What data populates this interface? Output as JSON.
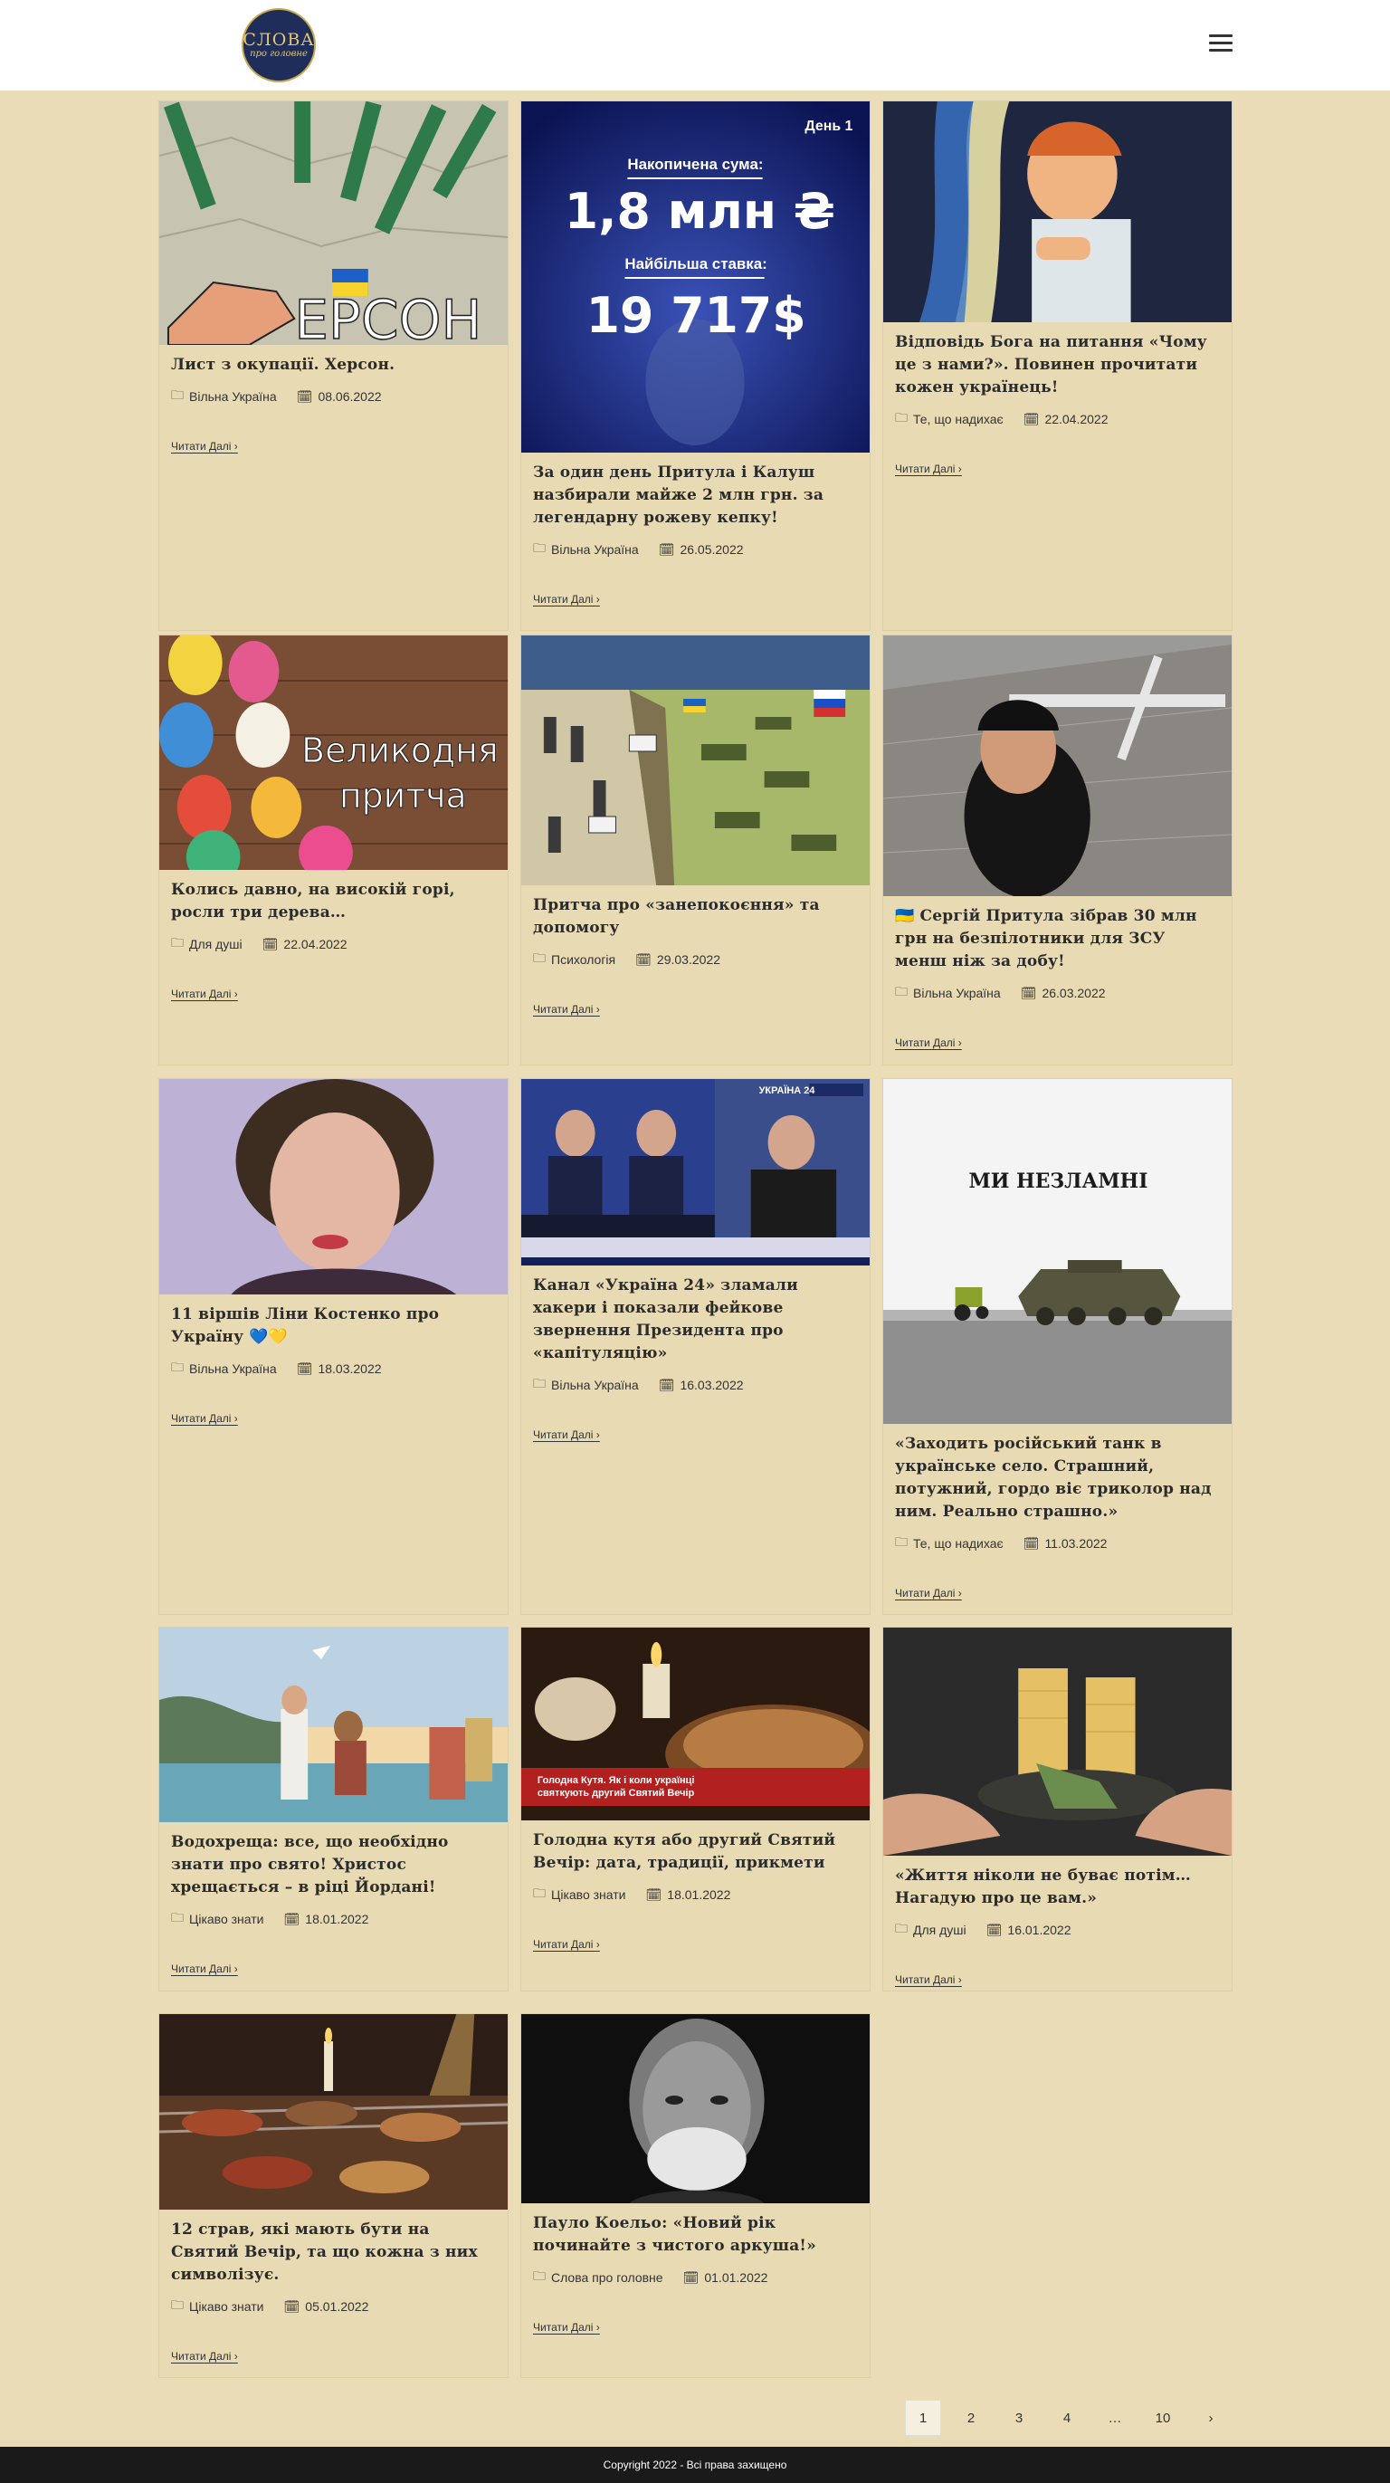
{
  "logo": {
    "line1": "СЛОВА",
    "line2": "про головне"
  },
  "read_more": "Читати Далі ›",
  "posts": [
    {
      "title": "Лист з окупації. Херсон.",
      "category": "Вільна Україна",
      "date": "08.06.2022"
    },
    {
      "title": "За один день Притула і Калуш назбирали майже 2 млн грн. за легендарну рожеву кепку!",
      "category": "Вільна Україна",
      "date": "26.05.2022"
    },
    {
      "title": "Відповідь Бога на питання «Чому це з нами?». Повинен прочитати кожен українець!",
      "category": "Те, що надихає",
      "date": "22.04.2022"
    },
    {
      "title": "Колись давно, на високій горі, росли три дерева…",
      "category": "Для душі",
      "date": "22.04.2022"
    },
    {
      "title": "Притча про «занепокоєння» та допомогу",
      "category": "Психологія",
      "date": "29.03.2022"
    },
    {
      "title": "🇺🇦 Сергій Притула зібрав 30 млн грн на безпілотники для ЗСУ менш ніж за добу!",
      "category": "Вільна Україна",
      "date": "26.03.2022"
    },
    {
      "title": "11 віршів Ліни Костенко про Україну 💙💛",
      "category": "Вільна Україна",
      "date": "18.03.2022"
    },
    {
      "title": "Канал «Україна 24» зламали хакери і показали фейкове звернення Президента про «капітуляцію»",
      "category": "Вільна Україна",
      "date": "16.03.2022"
    },
    {
      "title": "«Заходить російський танк в українське село. Страшний, потужний, гордо віє триколор над ним. Реально страшно.»",
      "category": "Те, що надихає",
      "date": "11.03.2022"
    },
    {
      "title": "Водохреща: все, що необхідно знати про свято! Христос хрещається – в ріці Йордані!",
      "category": "Цікаво знати",
      "date": "18.01.2022"
    },
    {
      "title": "Голодна кутя або другий Святий Вечір: дата, традиції, прикмети",
      "category": "Цікаво знати",
      "date": "18.01.2022"
    },
    {
      "title": "«Життя ніколи не буває потім… Нагадую про це вам.»",
      "category": "Для душі",
      "date": "16.01.2022"
    },
    {
      "title": "12 страв, які мають бути на Святий Вечір, та що кожна з них символізує.",
      "category": "Цікаво знати",
      "date": "05.01.2022"
    },
    {
      "title": "Пауло Коельо: «Новий рік починайте з чистого аркуша!»",
      "category": "Слова про головне",
      "date": "01.01.2022"
    }
  ],
  "image_text": {
    "kherson": "ЕРСОН",
    "day": "День 1",
    "accum_label": "Накопичена сума:",
    "accum_value": "1,8 млн ₴",
    "bid_label": "Найбільша ставка:",
    "bid_value": "19 717$",
    "easter": "Великодня притча",
    "ukr24": "УКРАЇНА 24",
    "unbroken": "МИ НЕЗЛАМНІ",
    "kutia": "Голодна Кутя. Як і коли українці святкують другий Святий Вечір"
  },
  "pagination": [
    "1",
    "2",
    "3",
    "4",
    "…",
    "10",
    "›"
  ],
  "footer": "Copyright 2022 - Всі права захищено"
}
